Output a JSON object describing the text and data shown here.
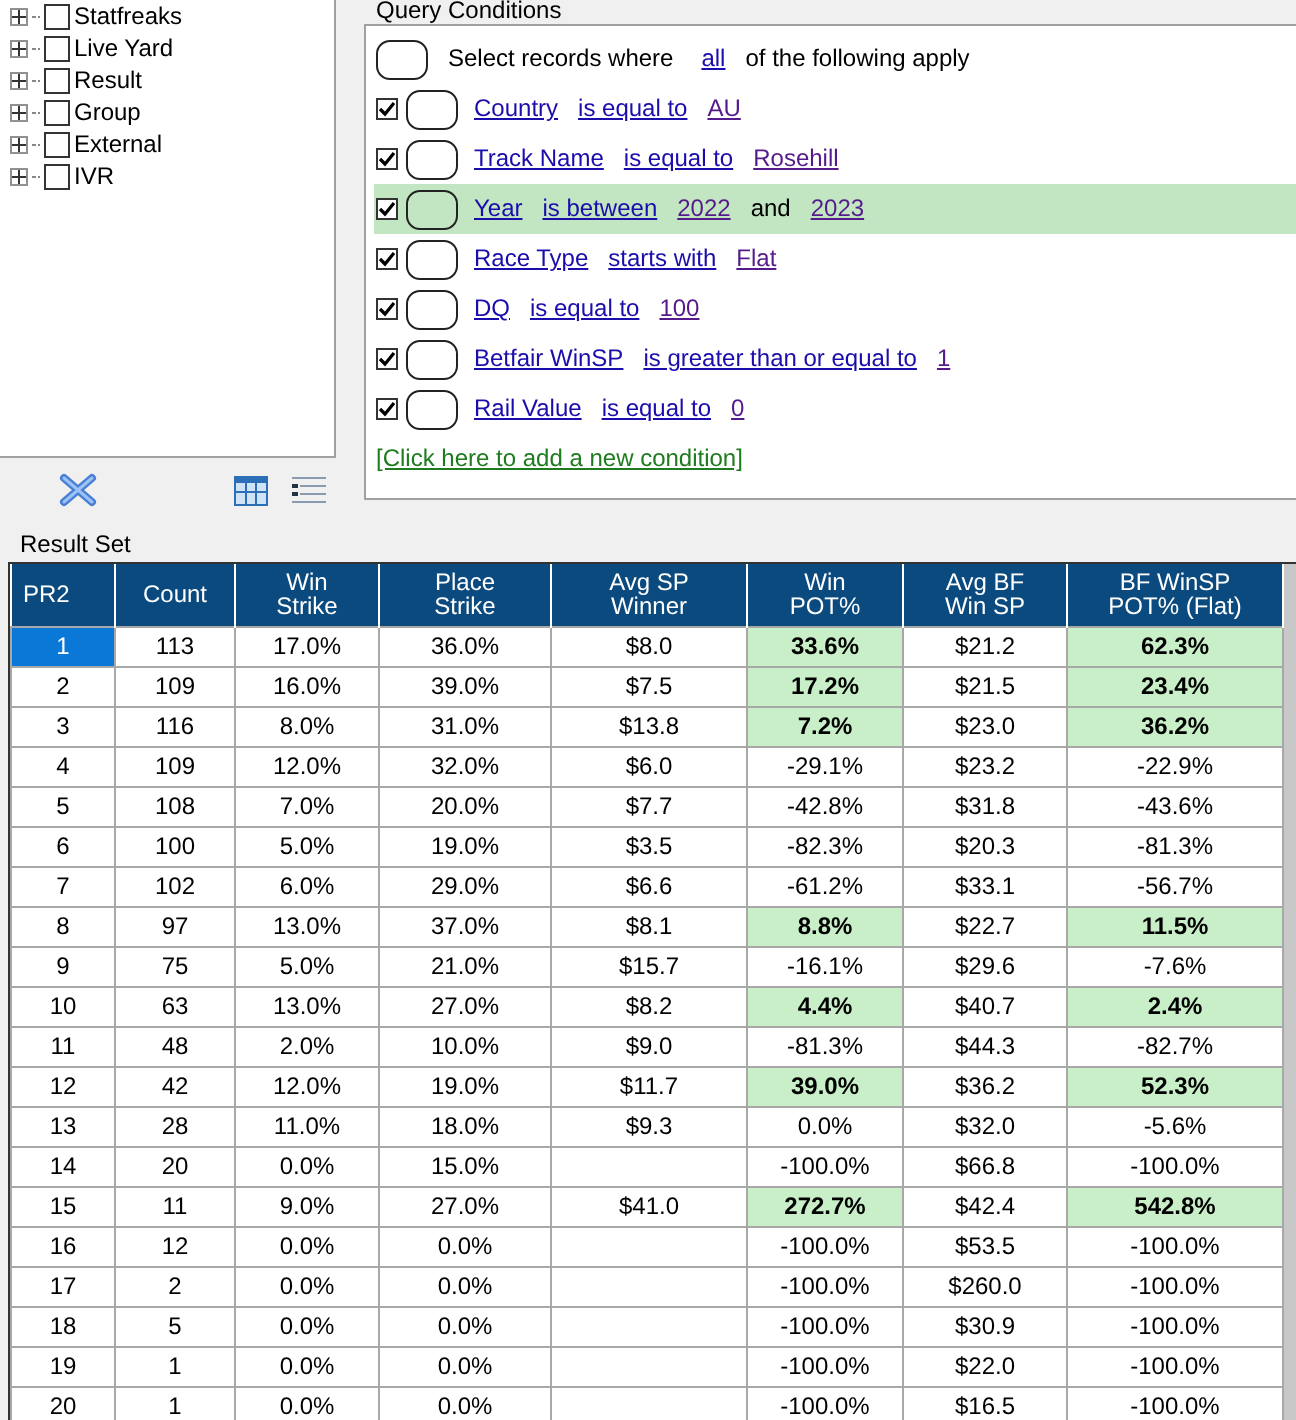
{
  "tree": {
    "items": [
      {
        "label": "Statfreaks",
        "checked": false,
        "expanded": false
      },
      {
        "label": "Live Yard",
        "checked": false,
        "expanded": false
      },
      {
        "label": "Result",
        "checked": false,
        "expanded": false
      },
      {
        "label": "Group",
        "checked": false,
        "expanded": false
      },
      {
        "label": "External",
        "checked": false,
        "expanded": false
      },
      {
        "label": "IVR",
        "checked": false,
        "expanded": false
      }
    ]
  },
  "query": {
    "title": "Query Conditions",
    "intro": {
      "before": "Select records where",
      "mode": "all",
      "after": "of the following apply"
    },
    "conditions": [
      {
        "checked": true,
        "selected": false,
        "field": "Country",
        "operator": "is equal to",
        "value": "AU"
      },
      {
        "checked": true,
        "selected": false,
        "field": "Track Name",
        "operator": "is equal to",
        "value": "Rosehill"
      },
      {
        "checked": true,
        "selected": true,
        "field": "Year",
        "operator": "is between",
        "value": "2022",
        "joiner": "and",
        "value_2": "2023"
      },
      {
        "checked": true,
        "selected": false,
        "field": "Race Type",
        "operator": "starts with",
        "value": "Flat"
      },
      {
        "checked": true,
        "selected": false,
        "field": "DQ",
        "operator": "is equal to",
        "value": "100"
      },
      {
        "checked": true,
        "selected": false,
        "field": "Betfair WinSP",
        "operator": "is greater than or equal to",
        "value": "1"
      },
      {
        "checked": true,
        "selected": false,
        "field": "Rail Value",
        "operator": "is equal to",
        "value": "0"
      }
    ],
    "add_link": "[Click here to add a new condition]"
  },
  "result_set": {
    "title": "Result Set",
    "columns": [
      "PR2",
      "Count",
      "Win\nStrike",
      "Place\nStrike",
      "Avg SP\nWinner",
      "Win\nPOT%",
      "Avg BF\nWin SP",
      "BF WinSP\nPOT% (Flat)"
    ],
    "rows": [
      {
        "selected": true,
        "highlighted": true,
        "cells": [
          "1",
          "113",
          "17.0%",
          "36.0%",
          "$8.0",
          "33.6%",
          "$21.2",
          "62.3%"
        ]
      },
      {
        "selected": false,
        "highlighted": true,
        "cells": [
          "2",
          "109",
          "16.0%",
          "39.0%",
          "$7.5",
          "17.2%",
          "$21.5",
          "23.4%"
        ]
      },
      {
        "selected": false,
        "highlighted": true,
        "cells": [
          "3",
          "116",
          "8.0%",
          "31.0%",
          "$13.8",
          "7.2%",
          "$23.0",
          "36.2%"
        ]
      },
      {
        "selected": false,
        "highlighted": false,
        "cells": [
          "4",
          "109",
          "12.0%",
          "32.0%",
          "$6.0",
          "-29.1%",
          "$23.2",
          "-22.9%"
        ]
      },
      {
        "selected": false,
        "highlighted": false,
        "cells": [
          "5",
          "108",
          "7.0%",
          "20.0%",
          "$7.7",
          "-42.8%",
          "$31.8",
          "-43.6%"
        ]
      },
      {
        "selected": false,
        "highlighted": false,
        "cells": [
          "6",
          "100",
          "5.0%",
          "19.0%",
          "$3.5",
          "-82.3%",
          "$20.3",
          "-81.3%"
        ]
      },
      {
        "selected": false,
        "highlighted": false,
        "cells": [
          "7",
          "102",
          "6.0%",
          "29.0%",
          "$6.6",
          "-61.2%",
          "$33.1",
          "-56.7%"
        ]
      },
      {
        "selected": false,
        "highlighted": true,
        "cells": [
          "8",
          "97",
          "13.0%",
          "37.0%",
          "$8.1",
          "8.8%",
          "$22.7",
          "11.5%"
        ]
      },
      {
        "selected": false,
        "highlighted": false,
        "cells": [
          "9",
          "75",
          "5.0%",
          "21.0%",
          "$15.7",
          "-16.1%",
          "$29.6",
          "-7.6%"
        ]
      },
      {
        "selected": false,
        "highlighted": true,
        "cells": [
          "10",
          "63",
          "13.0%",
          "27.0%",
          "$8.2",
          "4.4%",
          "$40.7",
          "2.4%"
        ]
      },
      {
        "selected": false,
        "highlighted": false,
        "cells": [
          "11",
          "48",
          "2.0%",
          "10.0%",
          "$9.0",
          "-81.3%",
          "$44.3",
          "-82.7%"
        ]
      },
      {
        "selected": false,
        "highlighted": true,
        "cells": [
          "12",
          "42",
          "12.0%",
          "19.0%",
          "$11.7",
          "39.0%",
          "$36.2",
          "52.3%"
        ]
      },
      {
        "selected": false,
        "highlighted": false,
        "cells": [
          "13",
          "28",
          "11.0%",
          "18.0%",
          "$9.3",
          "0.0%",
          "$32.0",
          "-5.6%"
        ]
      },
      {
        "selected": false,
        "highlighted": false,
        "cells": [
          "14",
          "20",
          "0.0%",
          "15.0%",
          "",
          "-100.0%",
          "$66.8",
          "-100.0%"
        ]
      },
      {
        "selected": false,
        "highlighted": true,
        "cells": [
          "15",
          "11",
          "9.0%",
          "27.0%",
          "$41.0",
          "272.7%",
          "$42.4",
          "542.8%"
        ]
      },
      {
        "selected": false,
        "highlighted": false,
        "cells": [
          "16",
          "12",
          "0.0%",
          "0.0%",
          "",
          "-100.0%",
          "$53.5",
          "-100.0%"
        ]
      },
      {
        "selected": false,
        "highlighted": false,
        "cells": [
          "17",
          "2",
          "0.0%",
          "0.0%",
          "",
          "-100.0%",
          "$260.0",
          "-100.0%"
        ]
      },
      {
        "selected": false,
        "highlighted": false,
        "cells": [
          "18",
          "5",
          "0.0%",
          "0.0%",
          "",
          "-100.0%",
          "$30.9",
          "-100.0%"
        ]
      },
      {
        "selected": false,
        "highlighted": false,
        "cells": [
          "19",
          "1",
          "0.0%",
          "0.0%",
          "",
          "-100.0%",
          "$22.0",
          "-100.0%"
        ]
      },
      {
        "selected": false,
        "highlighted": false,
        "cells": [
          "20",
          "1",
          "0.0%",
          "0.0%",
          "",
          "-100.0%",
          "$16.5",
          "-100.0%"
        ]
      }
    ]
  }
}
